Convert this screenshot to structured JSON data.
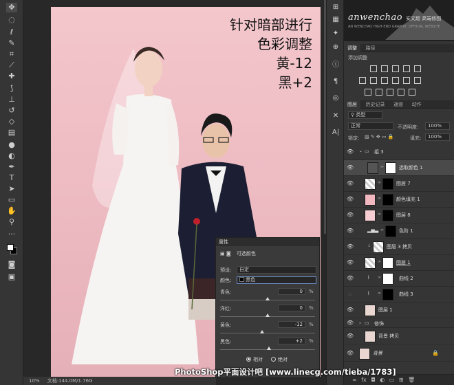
{
  "overlay_text": [
    "针对暗部进行",
    "色彩调整",
    "黄-12",
    "黑+2"
  ],
  "status": {
    "zoom": "10%",
    "doc": "文档:144.0M/1.76G"
  },
  "watermark": "PhotoShop平面设计吧 [www.linecg.com/tieba/1783]",
  "histogram": {
    "logo": "anwenchao",
    "subtitle": "AN WENCHAO HIGH-END GRAPHIC OFFICIAL WEBSITE",
    "cn": "安文超 高端修图"
  },
  "adjust_tabs": [
    "调整",
    "路径"
  ],
  "adjust_add_label": "添加调整",
  "layer_tabs": [
    "图层",
    "历史记录",
    "通道",
    "动作"
  ],
  "layer_controls": {
    "filter_kind": "类型",
    "blend_mode": "正常",
    "opacity_label": "不透明度:",
    "opacity": "100%",
    "lock_label": "锁定:",
    "fill_label": "填充:",
    "fill": "100%"
  },
  "layers": [
    {
      "name": "组 3",
      "kind": "group",
      "visible": true
    },
    {
      "name": "选取颜色 1",
      "kind": "adjustment",
      "visible": true,
      "selected": true
    },
    {
      "name": "图层 7",
      "kind": "masked",
      "visible": true
    },
    {
      "name": "颜色填充 1",
      "kind": "fill",
      "visible": true
    },
    {
      "name": "图层 8",
      "kind": "masked",
      "visible": true
    },
    {
      "name": "色阶 1",
      "kind": "adjustment",
      "visible": true
    },
    {
      "name": "图层 3 拷贝",
      "kind": "pixel",
      "visible": true
    },
    {
      "name": "图层 1",
      "kind": "masked",
      "visible": true
    },
    {
      "name": "曲线 2",
      "kind": "adjustment",
      "visible": true
    },
    {
      "name": "曲线 3",
      "kind": "adjustment",
      "visible": false
    },
    {
      "name": "图层 1",
      "kind": "photo",
      "visible": true
    },
    {
      "name": "修饰",
      "kind": "group",
      "visible": true
    },
    {
      "name": "背景 拷贝",
      "kind": "photo",
      "visible": true
    },
    {
      "name": "背景",
      "kind": "background",
      "visible": true
    }
  ],
  "properties": {
    "title": "属性",
    "subtitle": "可选颜色",
    "preset_label": "预设:",
    "preset_value": "自定",
    "colors_label": "颜色:",
    "colors_value": "黑色",
    "sliders": [
      {
        "label": "青色:",
        "value": "0",
        "unit": "%",
        "pct": 0
      },
      {
        "label": "洋红:",
        "value": "0",
        "unit": "%",
        "pct": 0
      },
      {
        "label": "黄色:",
        "value": "-12",
        "unit": "%",
        "pct": -12
      },
      {
        "label": "黑色:",
        "value": "+2",
        "unit": "%",
        "pct": 2
      }
    ],
    "mode_relative": "相对",
    "mode_absolute": "绝对",
    "selected_mode": "relative"
  },
  "colors": {
    "accent_bg": "#f3c7cc",
    "panel": "#353535",
    "selected_layer": "#4a4a4a"
  }
}
